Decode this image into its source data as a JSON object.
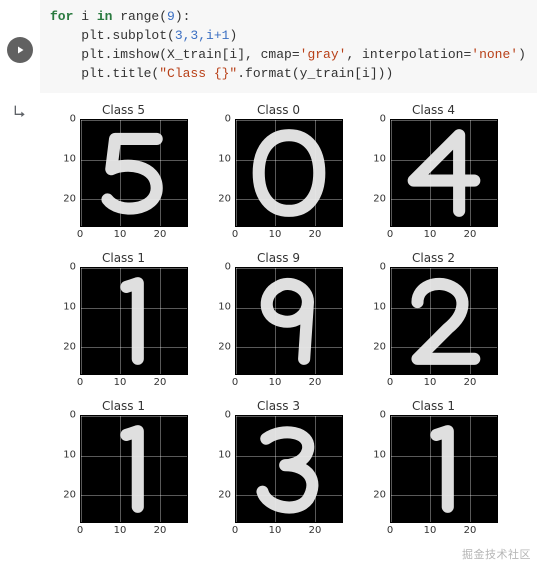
{
  "code": {
    "line1_kw_for": "for",
    "line1_var": " i ",
    "line1_kw_in": "in",
    "line1_rest": " range(",
    "line1_num": "9",
    "line1_end": "):",
    "line2_a": "    plt.subplot(",
    "line2_nums": "3,3,i+1",
    "line2_b": ")",
    "line3_a": "    plt.imshow(X_train[i], cmap=",
    "line3_s1": "'gray'",
    "line3_b": ", interpolation=",
    "line3_s2": "'none'",
    "line3_c": ")",
    "line4_a": "    plt.title(",
    "line4_s1": "\"Class {}\"",
    "line4_b": ".format(y_train[i]))"
  },
  "chart_data": {
    "type": "grid",
    "rows": 3,
    "cols": 3,
    "xticks": [
      0,
      10,
      20
    ],
    "yticks": [
      0,
      10,
      20
    ],
    "xlim": [
      0,
      27
    ],
    "ylim": [
      0,
      27
    ],
    "subplots": [
      {
        "title": "Class 5",
        "digit": 5
      },
      {
        "title": "Class 0",
        "digit": 0
      },
      {
        "title": "Class 4",
        "digit": 4
      },
      {
        "title": "Class 1",
        "digit": 1
      },
      {
        "title": "Class 9",
        "digit": 9
      },
      {
        "title": "Class 2",
        "digit": 2
      },
      {
        "title": "Class 1",
        "digit": 1
      },
      {
        "title": "Class 3",
        "digit": 3
      },
      {
        "title": "Class 1",
        "digit": 1
      }
    ]
  },
  "watermark": "掘金技术社区"
}
